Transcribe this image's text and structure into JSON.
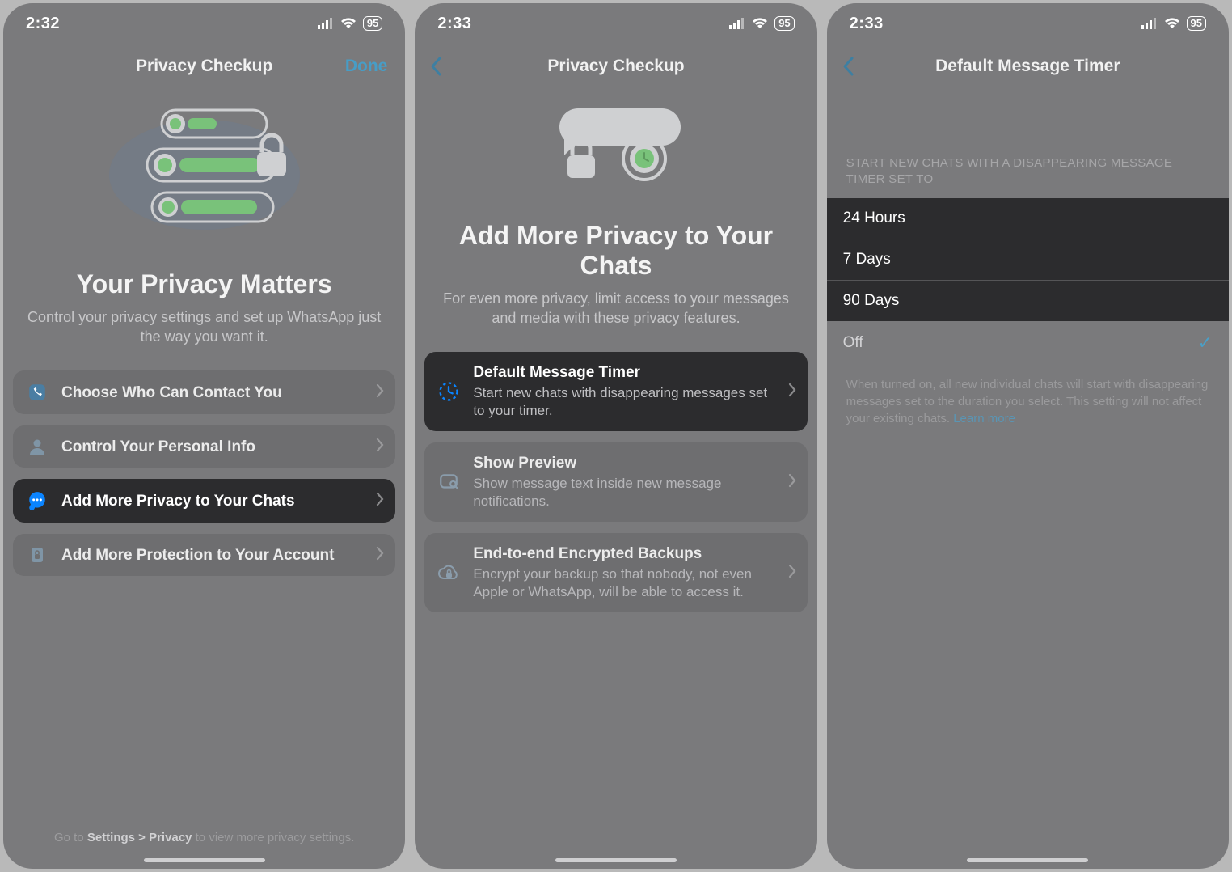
{
  "status": {
    "battery": "95"
  },
  "screen1": {
    "time": "2:32",
    "nav_title": "Privacy Checkup",
    "nav_done": "Done",
    "hero_title": "Your Privacy Matters",
    "hero_sub": "Control your privacy settings and set up WhatsApp just the way you want it.",
    "items": [
      {
        "title": "Choose Who Can Contact You"
      },
      {
        "title": "Control Your Personal Info"
      },
      {
        "title": "Add More Privacy to Your Chats"
      },
      {
        "title": "Add More Protection to Your Account"
      }
    ],
    "footer_pre": "Go to ",
    "footer_strong": "Settings > Privacy",
    "footer_post": " to view more privacy settings."
  },
  "screen2": {
    "time": "2:33",
    "nav_title": "Privacy Checkup",
    "hero_title": "Add More Privacy to Your Chats",
    "hero_sub": "For even more privacy, limit access to your messages and media with these privacy features.",
    "items": [
      {
        "title": "Default Message Timer",
        "sub": "Start new chats with disappearing messages set to your timer."
      },
      {
        "title": "Show Preview",
        "sub": "Show message text inside new message notifications."
      },
      {
        "title": "End-to-end Encrypted Backups",
        "sub": "Encrypt your backup so that nobody, not even Apple or WhatsApp, will be able to access it."
      }
    ]
  },
  "screen3": {
    "time": "2:33",
    "nav_title": "Default Message Timer",
    "section_header": "START NEW CHATS WITH A DISAPPEARING MESSAGE TIMER SET TO",
    "options": [
      "24 Hours",
      "7 Days",
      "90 Days",
      "Off"
    ],
    "selected_index": 3,
    "footnote": "When turned on, all new individual chats will start with disappearing messages set to the duration you select. This setting will not affect your existing chats. ",
    "learn_more": "Learn more"
  }
}
